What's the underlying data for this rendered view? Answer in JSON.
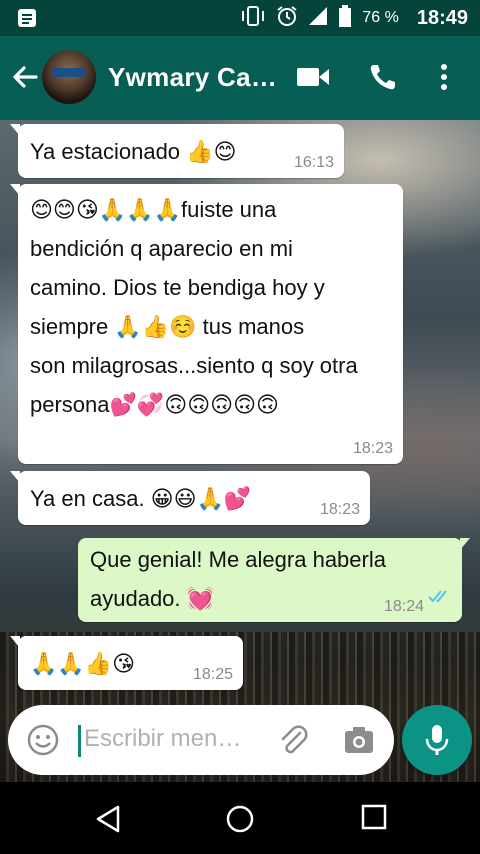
{
  "status_bar": {
    "battery_percent": "76 %",
    "time": "18:49"
  },
  "header": {
    "contact_name": "Ywmary Ca…",
    "icons": [
      "back-arrow-icon",
      "video-call-icon",
      "phone-icon",
      "more-vert-icon"
    ]
  },
  "messages": [
    {
      "direction": "in",
      "text": "Ya estacionado 👍😊",
      "time": "16:13"
    },
    {
      "direction": "in",
      "lines": [
        "😊😊😘🙏🙏🙏fuiste una",
        "bendición q aparecio en mi",
        "camino.  Dios te bendiga hoy y",
        "siempre 🙏👍☺️ tus manos",
        "son milagrosas...siento q soy otra",
        "persona💕💞🙃🙃🙃🙃🙃"
      ],
      "time": "18:23"
    },
    {
      "direction": "in",
      "text": "Ya en casa. 😀😃🙏💕",
      "time": "18:23"
    },
    {
      "direction": "out",
      "lines": [
        "Que genial! Me alegra haberla",
        "ayudado. 💓"
      ],
      "time": "18:24",
      "read": true
    },
    {
      "direction": "in",
      "text": "🙏🙏👍😘",
      "time": "18:25"
    }
  ],
  "composer": {
    "placeholder": "Escribir men…",
    "icons": [
      "emoji-icon",
      "attach-icon",
      "camera-icon",
      "mic-icon"
    ]
  },
  "colors": {
    "header": "#075e54",
    "status_bar": "#04443b",
    "incoming_bubble": "#ffffff",
    "outgoing_bubble": "#dcf8c6",
    "accent": "#0b9385",
    "read_ticks": "#4fc3f7"
  }
}
